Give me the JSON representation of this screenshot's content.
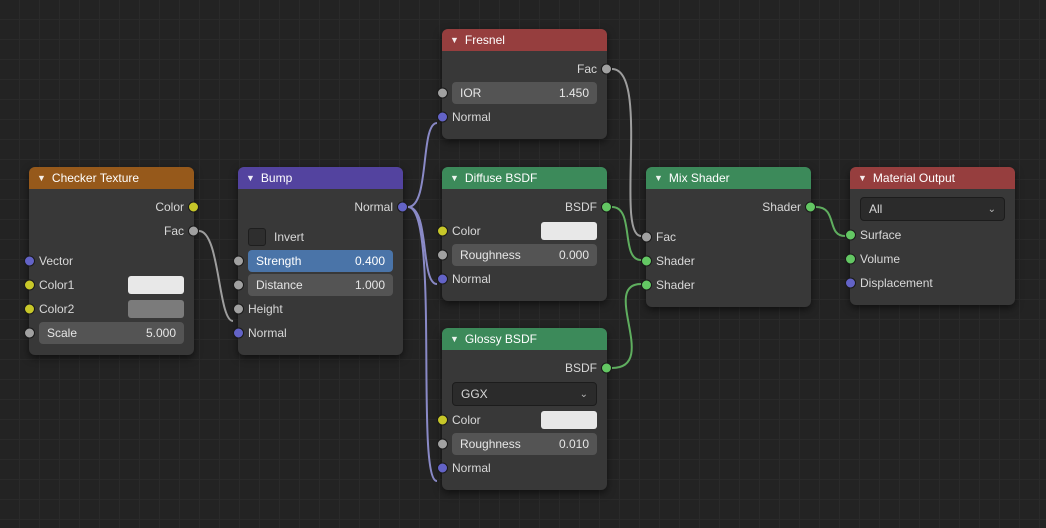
{
  "checker": {
    "title": "Checker Texture",
    "out_color": "Color",
    "out_fac": "Fac",
    "in_vector": "Vector",
    "in_color1": "Color1",
    "in_color2": "Color2",
    "scale_label": "Scale",
    "scale_value": "5.000"
  },
  "bump": {
    "title": "Bump",
    "out_normal": "Normal",
    "invert": "Invert",
    "strength_label": "Strength",
    "strength_value": "0.400",
    "distance_label": "Distance",
    "distance_value": "1.000",
    "in_height": "Height",
    "in_normal": "Normal"
  },
  "fresnel": {
    "title": "Fresnel",
    "out_fac": "Fac",
    "ior_label": "IOR",
    "ior_value": "1.450",
    "in_normal": "Normal"
  },
  "diffuse": {
    "title": "Diffuse BSDF",
    "out_bsdf": "BSDF",
    "in_color": "Color",
    "rough_label": "Roughness",
    "rough_value": "0.000",
    "in_normal": "Normal"
  },
  "glossy": {
    "title": "Glossy BSDF",
    "out_bsdf": "BSDF",
    "dist": "GGX",
    "in_color": "Color",
    "rough_label": "Roughness",
    "rough_value": "0.010",
    "in_normal": "Normal"
  },
  "mix": {
    "title": "Mix Shader",
    "out_shader": "Shader",
    "in_fac": "Fac",
    "in_shader1": "Shader",
    "in_shader2": "Shader"
  },
  "matout": {
    "title": "Material Output",
    "target": "All",
    "in_surface": "Surface",
    "in_volume": "Volume",
    "in_disp": "Displacement"
  }
}
